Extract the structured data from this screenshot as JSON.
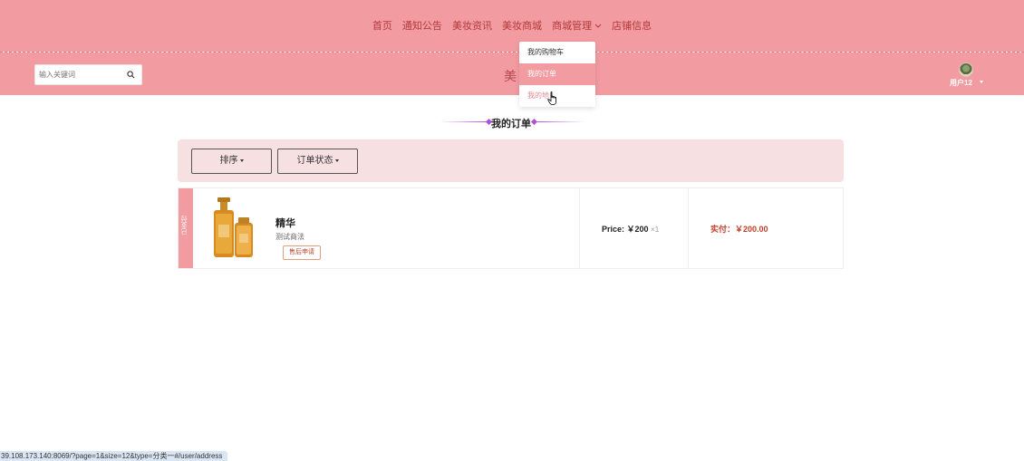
{
  "nav": {
    "items": [
      {
        "label": "首页"
      },
      {
        "label": "通知公告"
      },
      {
        "label": "美妆资讯"
      },
      {
        "label": "美妆商城"
      },
      {
        "label": "商城管理"
      },
      {
        "label": "店铺信息"
      }
    ]
  },
  "search": {
    "placeholder": "输入关键词"
  },
  "site_title": "美",
  "user": {
    "name": "用户12"
  },
  "dropdown": {
    "items": [
      {
        "label": "我的购物车"
      },
      {
        "label": "我的订单"
      },
      {
        "label": "我的地"
      }
    ]
  },
  "page": {
    "heading": "我的订单"
  },
  "filters": {
    "sort_label": "排序",
    "status_label": "订单状态"
  },
  "order": {
    "status": "已支付",
    "product_name": "精华",
    "product_desc": "测试商法",
    "after_sale_label": "售后申请",
    "price_label": "Price: ￥200",
    "quantity": "×1",
    "paid_label": "实付：￥200.00"
  },
  "status_url": "39.108.173.140:8069/?page=1&size=12&type=分类一#/user/address",
  "colors": {
    "header_bg": "#f29ba1",
    "accent_text": "#b23a3a",
    "price_red": "#c0402a",
    "filter_bg": "#f7e0e2"
  }
}
